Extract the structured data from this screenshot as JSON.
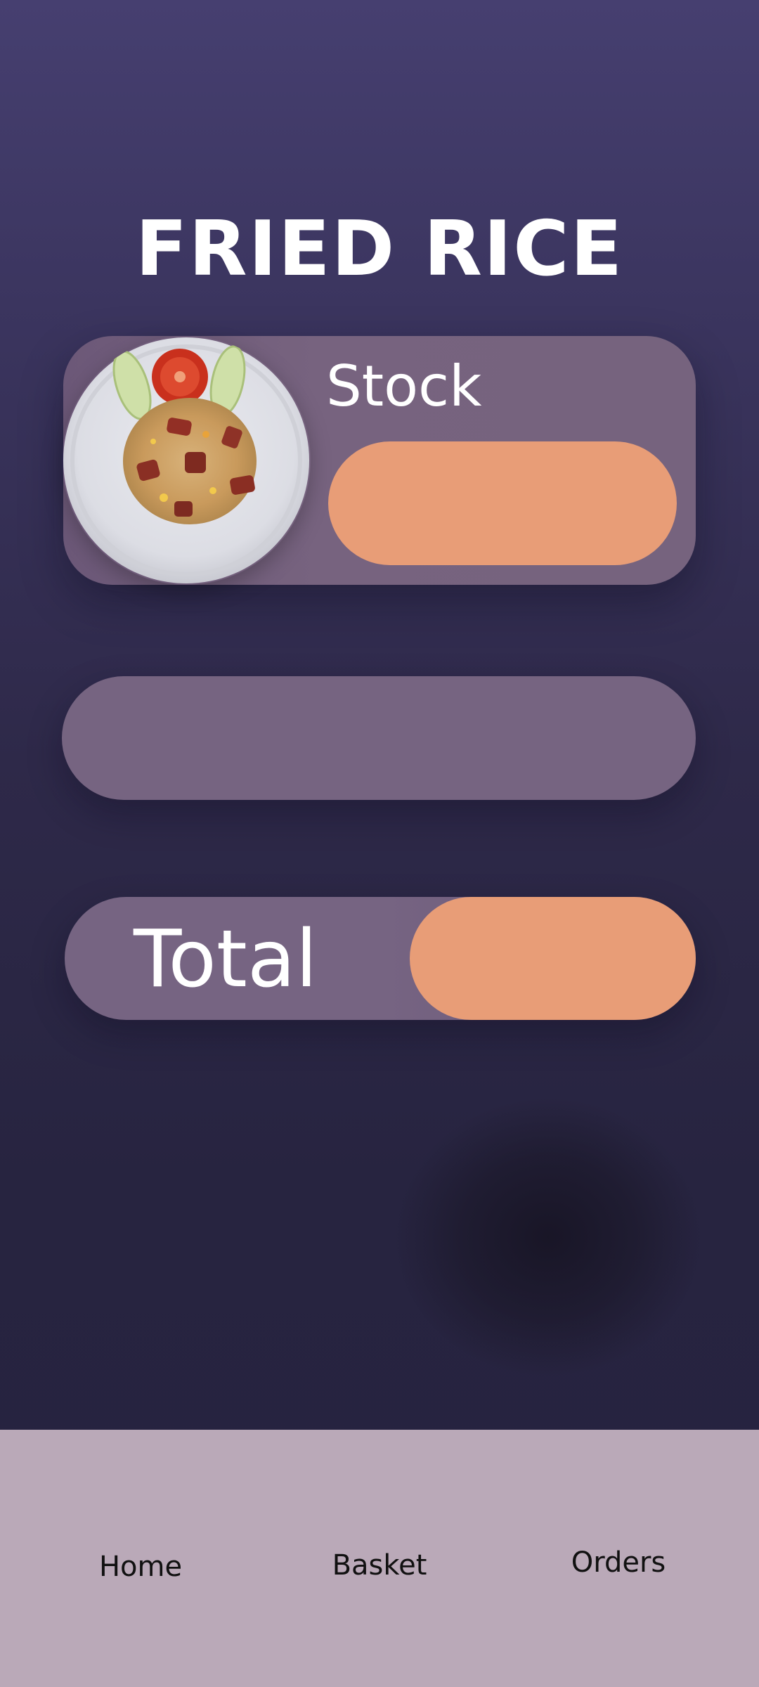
{
  "header": {
    "title": "FRIED RICE"
  },
  "stock_card": {
    "label": "Stock",
    "value": "",
    "image_icon": "fried-rice-plate"
  },
  "middle_field": {
    "value": ""
  },
  "total_bar": {
    "label": "Total",
    "value": ""
  },
  "bottom_nav": {
    "home": "Home",
    "basket": "Basket",
    "orders": "Orders"
  },
  "colors": {
    "background_top": "#463f70",
    "background_bottom": "#26223f",
    "card": "#766481",
    "accent": "#e89d77",
    "nav_background": "#baa9b8"
  }
}
